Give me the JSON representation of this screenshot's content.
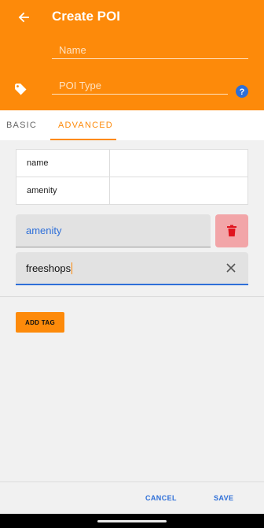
{
  "header": {
    "title": "Create POI",
    "name_placeholder": "Name",
    "type_placeholder": "POI Type"
  },
  "tabs": [
    {
      "label": "BASIC"
    },
    {
      "label": "ADVANCED"
    }
  ],
  "tag_table": {
    "rows": [
      {
        "key": "name",
        "value": ""
      },
      {
        "key": "amenity",
        "value": ""
      }
    ]
  },
  "tag_editor": {
    "key": "amenity",
    "value": "freeshops"
  },
  "actions": {
    "add_tag_label": "ADD TAG",
    "cancel_label": "CANCEL",
    "save_label": "SAVE"
  },
  "colors": {
    "accent": "#fd8a0a",
    "link": "#2e6fd8",
    "delete_bg": "#f2a5a8",
    "delete_icon": "#e0141e",
    "help": "#2e6fd8"
  },
  "icons": [
    "back-arrow-icon",
    "tag-icon",
    "help-icon",
    "trash-icon",
    "clear-icon"
  ]
}
